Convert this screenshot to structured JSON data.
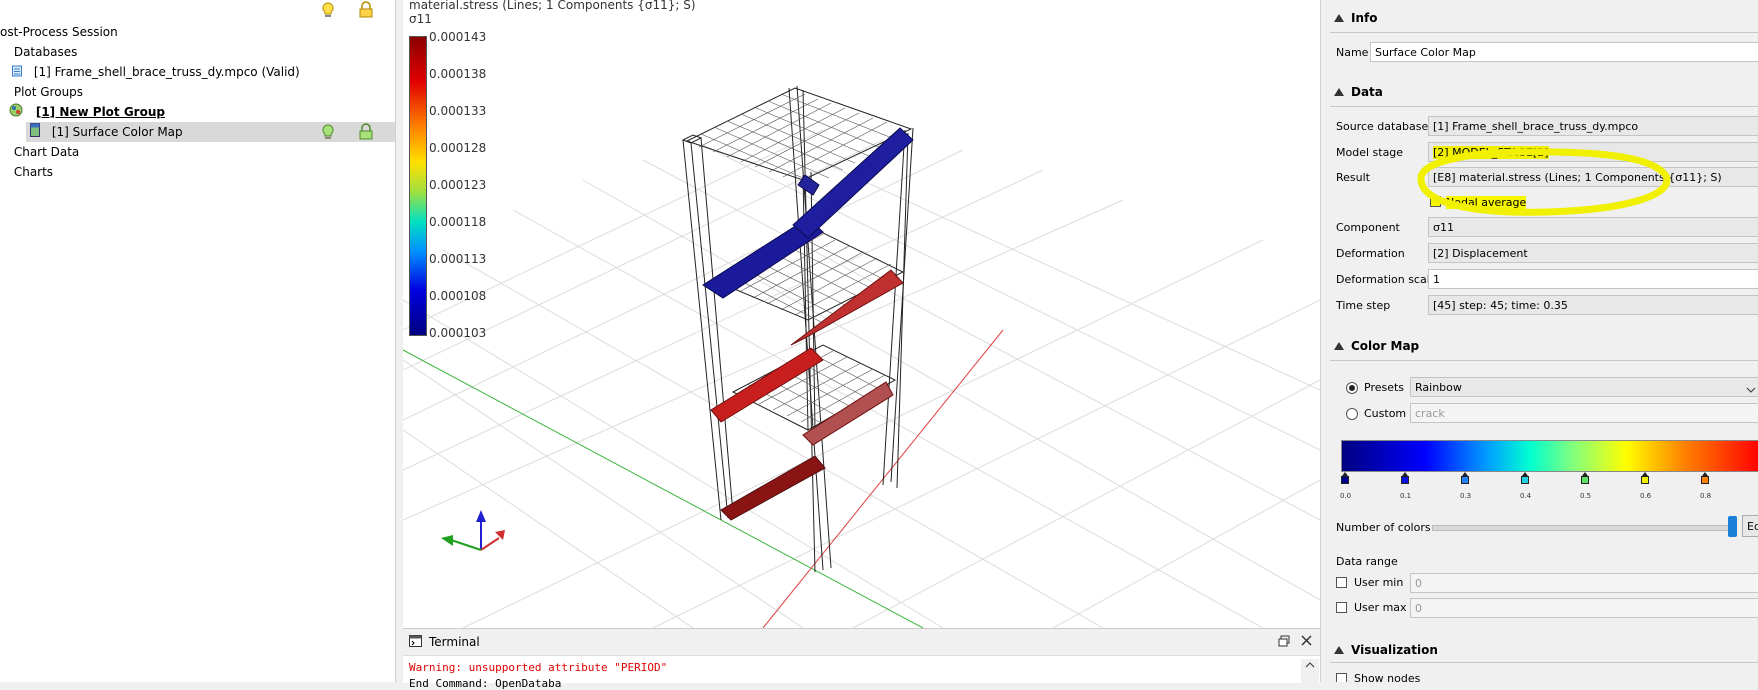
{
  "tree": {
    "session": "ost-Process Session",
    "databases": "Databases",
    "database_item": "[1] Frame_shell_brace_truss_dy.mpco (Valid)",
    "plot_groups": "Plot Groups",
    "plot_group_item": "[1] New Plot Group",
    "plot_item": "[1] Surface Color Map",
    "chart_data": "Chart Data",
    "charts": "Charts"
  },
  "viewport": {
    "title": "material.stress (Lines; 1 Components {σ11}; S)",
    "component": "σ11",
    "colorbar": {
      "labels": [
        "0.000143",
        "0.000138",
        "0.000133",
        "0.000128",
        "0.000123",
        "0.000118",
        "0.000113",
        "0.000108",
        "0.000103"
      ],
      "min": 0.000103,
      "max": 0.000143
    }
  },
  "terminal": {
    "title": "Terminal",
    "warning": "Warning: unsupported attribute \"PERIOD\"",
    "line2": "End Command: OpenDataba"
  },
  "props": {
    "info": {
      "header": "Info",
      "name_label": "Name",
      "name_value": "Surface Color Map"
    },
    "data": {
      "header": "Data",
      "source_label": "Source database",
      "source_value": "[1] Frame_shell_brace_truss_dy.mpco",
      "model_stage_label": "Model stage",
      "model_stage_value": "[2] MODEL_STAGE[2]",
      "result_label": "Result",
      "result_value": "[E8] material.stress (Lines; 1 Components {σ11}; S)",
      "nodal_average_label": "Nodal average",
      "component_label": "Component",
      "component_value": "σ11",
      "deformation_label": "Deformation",
      "deformation_value": "[2] Displacement",
      "deformation_scale_label": "Deformation scale",
      "deformation_scale_value": "1",
      "time_step_label": "Time step",
      "time_step_value": "[45] step: 45; time: 0.35"
    },
    "color_map": {
      "header": "Color Map",
      "presets_label": "Presets",
      "presets_value": "Rainbow",
      "custom_label": "Custom",
      "custom_value": "crack",
      "ticks": [
        "0.0",
        "0.1",
        "0.3",
        "0.4",
        "0.5",
        "0.6",
        "0.8"
      ],
      "number_of_colors_label": "Number of colors",
      "number_of_colors_button": "Ed",
      "data_range_label": "Data range",
      "user_min_label": "User min",
      "user_min_value": "0",
      "user_max_label": "User max",
      "user_max_value": "0"
    },
    "visualization": {
      "header": "Visualization",
      "show_nodes_label": "Show nodes"
    }
  },
  "colors": {
    "highlight": "#f0f000",
    "selection": "#d9d9d9",
    "warning_text": "#e00000"
  }
}
